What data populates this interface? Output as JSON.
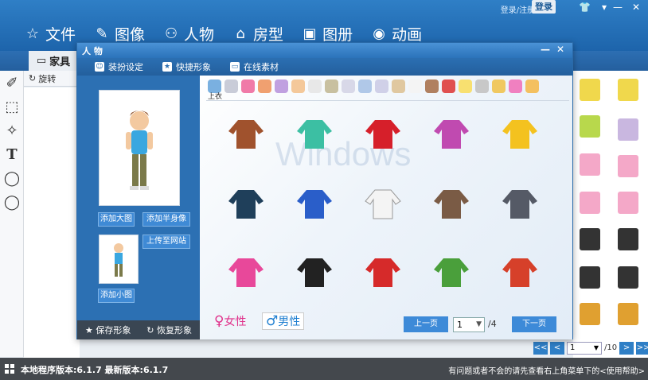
{
  "topbar": {
    "login_hint": "登录/注册帐号",
    "login_button": "登录",
    "menu": [
      {
        "label": "文件",
        "icon": "star-icon"
      },
      {
        "label": "图像",
        "icon": "brush-icon"
      },
      {
        "label": "人物",
        "icon": "people-icon"
      },
      {
        "label": "房型",
        "icon": "house-icon"
      },
      {
        "label": "图册",
        "icon": "picture-icon"
      },
      {
        "label": "动画",
        "icon": "globe-icon"
      }
    ]
  },
  "subbar": {
    "furniture_tab": "家具",
    "rotate": "旋转"
  },
  "dialog": {
    "title": "人 物",
    "tabs": [
      "装扮设定",
      "快捷形象",
      "在线素材"
    ],
    "category_label": "上衣",
    "buttons": {
      "add_big": "添加大图",
      "add_half": "添加半身像",
      "upload": "上传至网站",
      "add_small": "添加小图",
      "save": "保存形象",
      "restore": "恢复形象"
    },
    "gender": {
      "female": "女性",
      "male": "男性"
    },
    "pager": {
      "prev": "上一页",
      "next": "下一页",
      "current": "1",
      "total": "/4"
    },
    "watermark": "Windows"
  },
  "right_pager": {
    "first": "<<",
    "prev": "<",
    "current": "1",
    "total": "/10",
    "next": ">",
    "last": ">>"
  },
  "status": {
    "version": "本地程序版本:6.1.7   最新版本:6.1.7",
    "help": "有问题或者不会的请先查看右上角菜单下的<使用帮助>"
  },
  "colors": {
    "accent": "#2f7fc6",
    "items": [
      "#a0522d",
      "#3cbfa3",
      "#d61f2a",
      "#c04ab0",
      "#f4c21f",
      "#1f3f5a",
      "#2a5ec9",
      "#f4f4f4",
      "#7a5b45",
      "#555a66",
      "#e8489a",
      "#222222",
      "#d62a2a",
      "#4a9f3b",
      "#d6402a"
    ]
  }
}
